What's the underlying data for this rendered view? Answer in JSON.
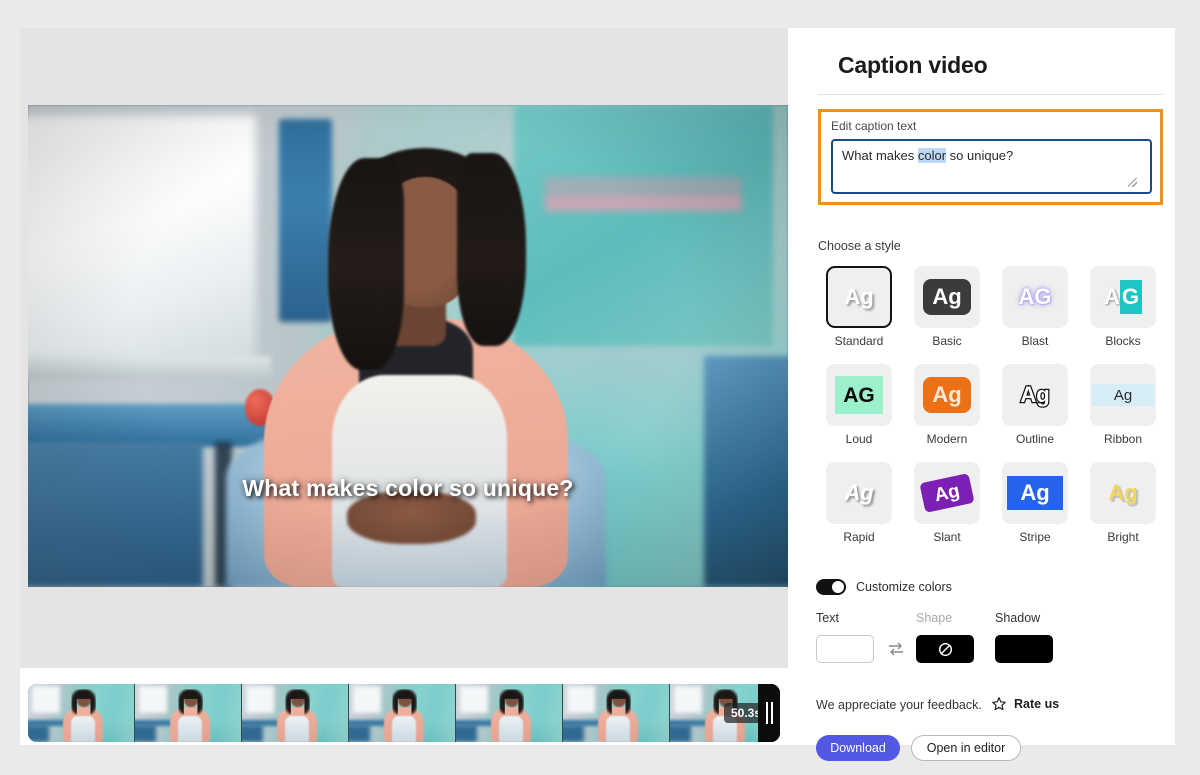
{
  "panel": {
    "title": "Caption video",
    "edit_label": "Edit caption text",
    "caption_text_before": "What makes ",
    "caption_text_selected": "color",
    "caption_text_after": " so unique?",
    "choose_style_label": "Choose a style"
  },
  "video": {
    "caption_overlay": "What makes color so unique?",
    "duration_badge": "50.3s"
  },
  "styles": [
    {
      "name": "Standard",
      "selected": true,
      "icon": "ag-standard-icon"
    },
    {
      "name": "Basic",
      "selected": false,
      "icon": "ag-basic-icon"
    },
    {
      "name": "Blast",
      "selected": false,
      "icon": "ag-blast-icon"
    },
    {
      "name": "Blocks",
      "selected": false,
      "icon": "ag-blocks-icon"
    },
    {
      "name": "Loud",
      "selected": false,
      "icon": "ag-loud-icon"
    },
    {
      "name": "Modern",
      "selected": false,
      "icon": "ag-modern-icon"
    },
    {
      "name": "Outline",
      "selected": false,
      "icon": "ag-outline-icon"
    },
    {
      "name": "Ribbon",
      "selected": false,
      "icon": "ag-ribbon-icon"
    },
    {
      "name": "Rapid",
      "selected": false,
      "icon": "ag-rapid-icon"
    },
    {
      "name": "Slant",
      "selected": false,
      "icon": "ag-slant-icon"
    },
    {
      "name": "Stripe",
      "selected": false,
      "icon": "ag-stripe-icon"
    },
    {
      "name": "Bright",
      "selected": false,
      "icon": "ag-bright-icon"
    }
  ],
  "style_glyph": {
    "ag": "Ag",
    "a": "A",
    "g": "G",
    "ag_upper": "AG"
  },
  "customize": {
    "toggle_label": "Customize colors",
    "toggle_on": true,
    "text_label": "Text",
    "shape_label": "Shape",
    "shadow_label": "Shadow",
    "text_color": "#ffffff",
    "shape_color": "#000000",
    "shape_disabled": true,
    "shadow_color": "#000000",
    "swap_icon": "swap-arrows-icon"
  },
  "footer": {
    "feedback_text": "We appreciate your feedback.",
    "rate_label": "Rate us",
    "rate_icon": "star-icon",
    "download_label": "Download",
    "editor_label": "Open in editor",
    "download_color": "#5258e4"
  },
  "accents": {
    "highlight_border": "#e8921f",
    "focus_border": "#1a4a8a",
    "selection_bg": "#bcd9f5"
  }
}
